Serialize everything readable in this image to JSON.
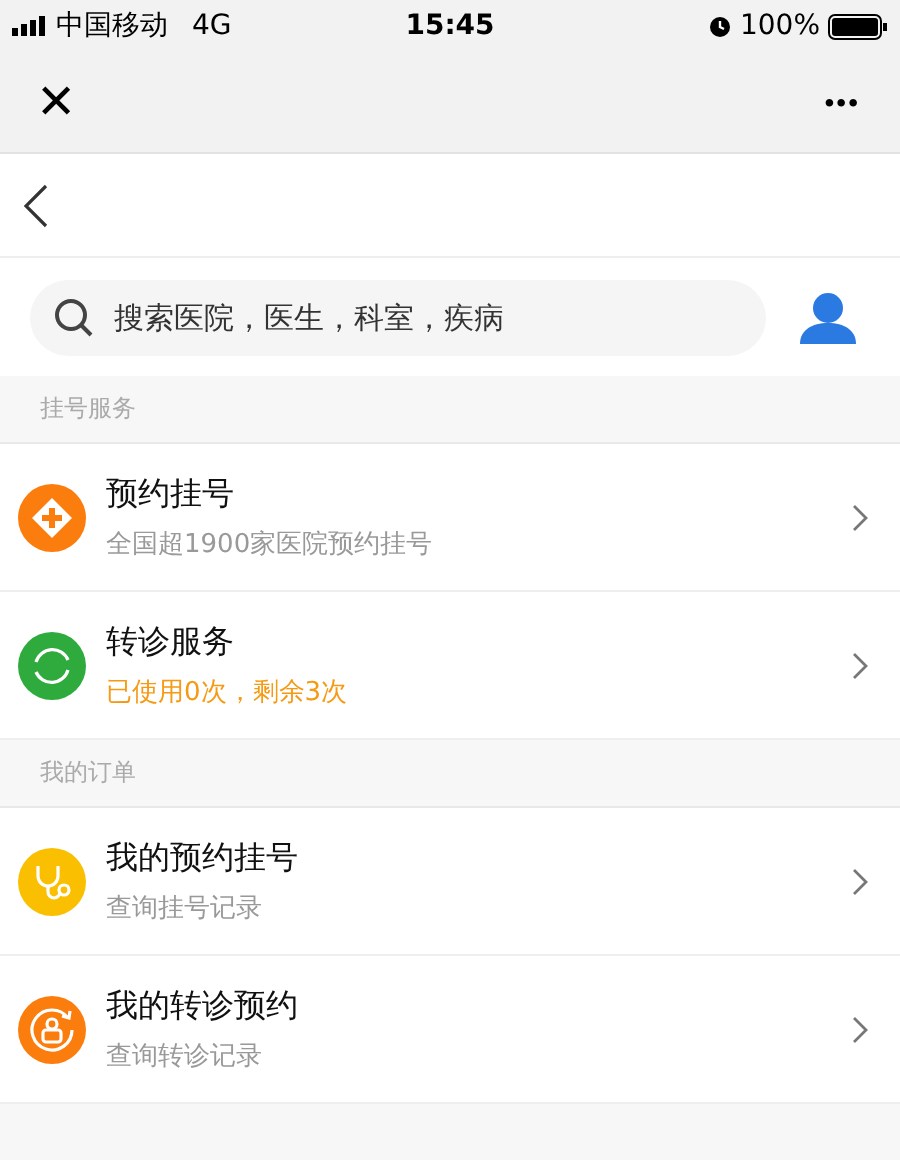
{
  "status_bar": {
    "carrier": "中国移动",
    "network": "4G",
    "time": "15:45",
    "battery": "100%"
  },
  "nav": {
    "close": "✕",
    "more": "•••"
  },
  "search": {
    "placeholder": "搜索医院，医生，科室，疾病"
  },
  "sections": [
    {
      "title": "挂号服务",
      "items": [
        {
          "kind": "plus",
          "color": "#fb7d0d",
          "title": "预约挂号",
          "subtitle": "全国超1900家医院预约挂号",
          "highlight": false
        },
        {
          "kind": "cycle",
          "color": "#2eab3c",
          "title": "转诊服务",
          "subtitle": "已使用0次，剩余3次",
          "highlight": true
        }
      ]
    },
    {
      "title": "我的订单",
      "items": [
        {
          "kind": "stethoscope",
          "color": "#f9bf00",
          "title": "我的预约挂号",
          "subtitle": "查询挂号记录",
          "highlight": false
        },
        {
          "kind": "transfer",
          "color": "#fb7d0d",
          "title": "我的转诊预约",
          "subtitle": "查询转诊记录",
          "highlight": false
        }
      ]
    }
  ]
}
